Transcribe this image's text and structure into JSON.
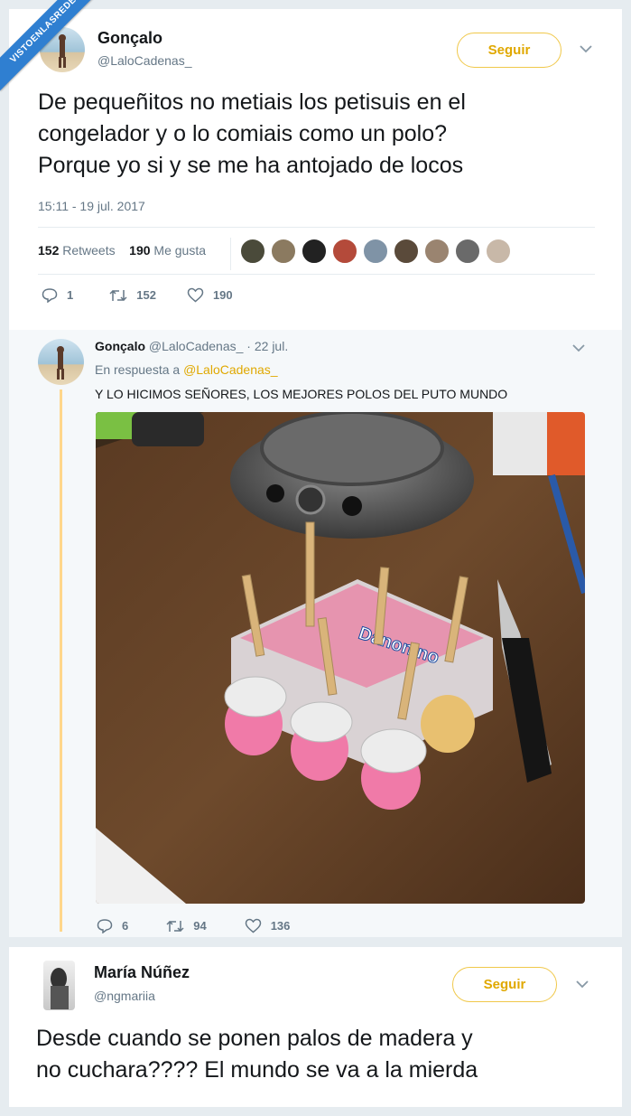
{
  "watermark": "VISTOENLASREDES",
  "tweet1": {
    "name": "Gonçalo",
    "handle": "@LaloCadenas_",
    "follow": "Seguir",
    "text_lines": [
      "De pequeñitos no metiais los petisuis en el",
      "congelador y o lo comiais como un polo?",
      "Porque yo si y se me ha antojado de locos"
    ],
    "timestamp": "15:11 - 19 jul. 2017",
    "retweets_count": "152",
    "retweets_label": "Retweets",
    "likes_count": "190",
    "likes_label": "Me gusta",
    "actions": {
      "reply": "1",
      "retweet": "152",
      "like": "190"
    }
  },
  "tweet2": {
    "name": "Gonçalo",
    "handle_date": "@LaloCadenas_ · 22 jul.",
    "in_reply_prefix": "En respuesta a",
    "in_reply_handle": "@LaloCadenas_",
    "text": "Y LO HICIMOS SEÑORES, LOS MEJORES POLOS DEL PUTO MUNDO",
    "photo_label": "Danonino",
    "actions": {
      "reply": "6",
      "retweet": "94",
      "like": "136"
    }
  },
  "tweet3": {
    "name": "María Núñez",
    "handle": "@ngmariia",
    "follow": "Seguir",
    "text_lines": [
      "Desde cuando se ponen palos de madera y",
      "no cuchara???? El mundo se va a la mierda"
    ]
  },
  "colors": {
    "accent": "#e0a800",
    "icon": "#657786",
    "ribbon": "#2f7fd1"
  }
}
